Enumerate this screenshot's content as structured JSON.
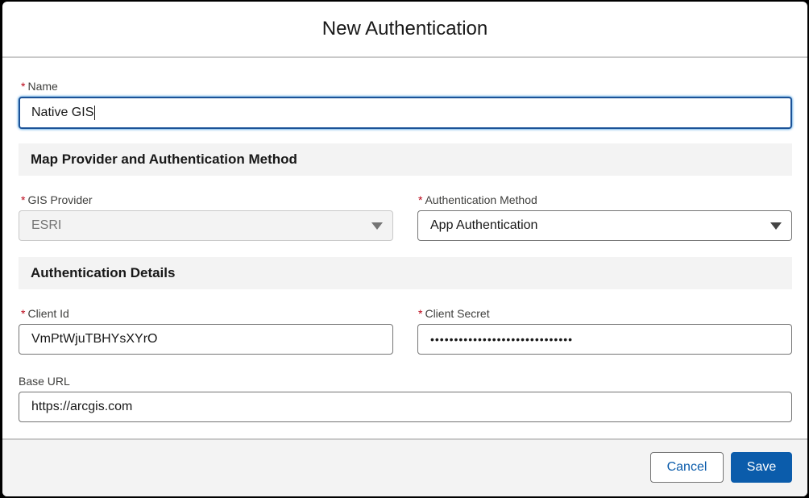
{
  "dialog": {
    "title": "New Authentication"
  },
  "required_marker": "*",
  "name_field": {
    "label": "Name",
    "value": "Native GIS"
  },
  "sections": {
    "map_provider": "Map Provider and Authentication Method",
    "auth_details": "Authentication Details"
  },
  "gis_provider": {
    "label": "GIS Provider",
    "value": "ESRI",
    "disabled": true
  },
  "auth_method": {
    "label": "Authentication Method",
    "value": "App Authentication"
  },
  "client_id": {
    "label": "Client Id",
    "value": "VmPtWjuTBHYsXYrO"
  },
  "client_secret": {
    "label": "Client Secret",
    "masked_value": "••••••••••••••••••••••••••••••"
  },
  "base_url": {
    "label": "Base URL",
    "value": "https://arcgis.com"
  },
  "footer": {
    "cancel_label": "Cancel",
    "save_label": "Save"
  },
  "colors": {
    "brand": "#0b5cab",
    "focus_border": "#1b5297",
    "required": "#ba0517"
  },
  "icons": {
    "dropdown": "chevron-down-icon"
  }
}
